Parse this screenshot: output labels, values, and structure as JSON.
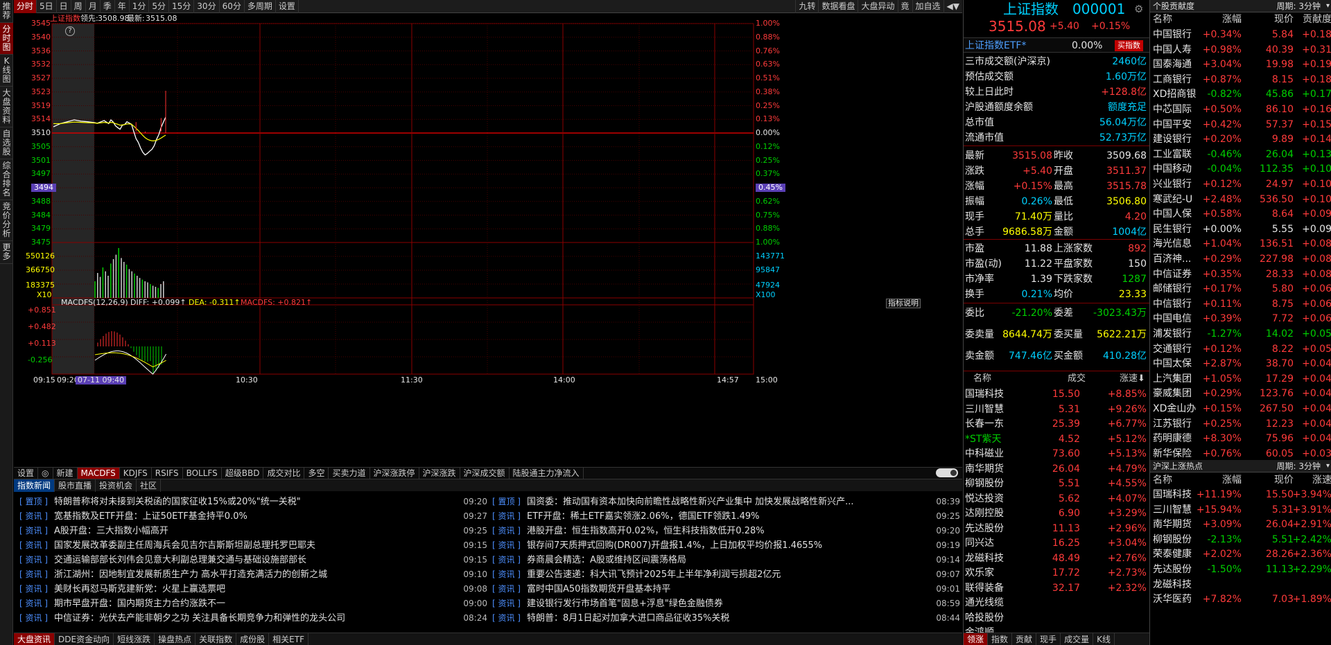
{
  "sidebar": [
    "推荐",
    "分时图",
    "K线图",
    "大盘资料",
    "自选股",
    "综合排名",
    "竞价分析",
    "更多"
  ],
  "toolbar": {
    "left": [
      "分时",
      "5日",
      "日",
      "周",
      "月",
      "季",
      "年",
      "1分",
      "5分",
      "15分",
      "30分",
      "60分",
      "多周期",
      "设置"
    ],
    "right": [
      "九转",
      "数据看盘",
      "大盘异动",
      "竟",
      "加自选",
      "◀▼"
    ]
  },
  "chart": {
    "title": "上证指数",
    "lead_label": "领先:",
    "lead_value": "3508.98",
    "latest_label": "最新:",
    "latest_value": "3515.08",
    "price_levels": [
      "3545",
      "3540",
      "3536",
      "3532",
      "3527",
      "3523",
      "3519",
      "3514",
      "3510",
      "3505",
      "3501",
      "3497",
      "3494",
      "3488",
      "3484",
      "3479",
      "3475"
    ],
    "pct_levels": [
      "1.00%",
      "0.88%",
      "0.76%",
      "0.63%",
      "0.51%",
      "0.38%",
      "0.25%",
      "0.13%",
      "0.00%",
      "0.12%",
      "0.25%",
      "0.37%",
      "0.45%",
      "0.62%",
      "0.75%",
      "0.88%",
      "1.00%"
    ],
    "vol_left": [
      "550126",
      "366750",
      "183375",
      "X10"
    ],
    "vol_right": [
      "143771",
      "95847",
      "47924",
      "X100"
    ],
    "macd_levels": [
      "+0.851",
      "+0.482",
      "+0.113",
      "-0.256"
    ],
    "macd_label": "MACDFS(12,26,9)",
    "macd_diff": "DIFF: +0.099↑",
    "macd_dea": "DEA: -0.311↑",
    "macd_macdfs": "MACDFS: +0.821↑",
    "indicator_button": "指标说明",
    "time_labels": [
      "09:15",
      "09:20",
      "10:30",
      "11:30",
      "14:00",
      "14:57",
      "15:00"
    ],
    "cursor_time": "07-11 09:40",
    "help": "?"
  },
  "index_tabs": [
    "设置",
    "◎",
    "新建",
    "MACDFS",
    "KDJFS",
    "RSIFS",
    "BOLLFS",
    "超级BBD",
    "成交对比",
    "多空",
    "买卖力道",
    "沪深涨跌停",
    "沪深涨跌",
    "沪深成交额",
    "陆股通主力净流入"
  ],
  "news_tabs": [
    "指数新闻",
    "股市直播",
    "投资机会",
    "社区"
  ],
  "news_left": [
    {
      "tag": "[ 置顶 ]",
      "title": "特朗普称将对未接到关税函的国家征收15%或20%\"统一关税\"",
      "time": "09:20"
    },
    {
      "tag": "[ 资讯 ]",
      "title": "宽基指数及ETF开盘：上证50ETF基金持平0.0%",
      "time": "09:27"
    },
    {
      "tag": "[ 资讯 ]",
      "title": "A股开盘：三大指数小幅高开",
      "time": "09:25"
    },
    {
      "tag": "[ 资讯 ]",
      "title": "国家发展改革委副主任周海兵会见吉尔吉斯斯坦副总理托罗巴耶夫",
      "time": "09:15"
    },
    {
      "tag": "[ 资讯 ]",
      "title": "交通运输部部长刘伟会见意大利副总理兼交通与基础设施部部长",
      "time": "09:15"
    },
    {
      "tag": "[ 资讯 ]",
      "title": "浙江湖州：因地制宜发展新质生产力 高水平打造充满活力的创新之城",
      "time": "09:10"
    },
    {
      "tag": "[ 资讯 ]",
      "title": "美财长再怼马斯克建新党：火星上赢选票吧",
      "time": "09:08"
    },
    {
      "tag": "[ 资讯 ]",
      "title": "期市早盘开盘：国内期货主力合约涨跌不一",
      "time": "09:00"
    },
    {
      "tag": "[ 资讯 ]",
      "title": "中信证券：光伏去产能非朝夕之功 关注具备长期竞争力和弹性的龙头公司",
      "time": "08:24"
    }
  ],
  "news_right": [
    {
      "tag": "[ 置顶 ]",
      "title": "国资委：推动国有资本加快向前瞻性战略性新兴产业集中 加快发展战略性新兴产...",
      "time": "08:39"
    },
    {
      "tag": "[ 资讯 ]",
      "title": "ETF开盘：稀土ETF嘉实领涨2.06%，德国ETF领跌1.49%",
      "time": "09:25"
    },
    {
      "tag": "[ 资讯 ]",
      "title": "港股开盘：恒生指数高开0.02%，恒生科技指数低开0.28%",
      "time": "09:20"
    },
    {
      "tag": "[ 资讯 ]",
      "title": "银存间7天质押式回购(DR007)开盘报1.4%，上日加权平均价报1.4655%",
      "time": "09:19"
    },
    {
      "tag": "[ 资讯 ]",
      "title": "券商晨会精选：A股或维持区间震荡格局",
      "time": "09:14"
    },
    {
      "tag": "[ 资讯 ]",
      "title": "重要公告速递：科大讯飞预计2025年上半年净利润亏损超2亿元",
      "time": "09:07"
    },
    {
      "tag": "[ 资讯 ]",
      "title": "富时中国A50指数期货开盘基本持平",
      "time": "09:01"
    },
    {
      "tag": "[ 资讯 ]",
      "title": "建设银行发行市场首笔\"固息+浮息\"绿色金融债券",
      "time": "08:59"
    },
    {
      "tag": "[ 资讯 ]",
      "title": "特朗普：8月1日起对加拿大进口商品征收35%关税",
      "time": "08:44"
    }
  ],
  "bottom_tabs": [
    "大盘资讯",
    "DDE资金动向",
    "短线涨跌",
    "操盘热点",
    "关联指数",
    "成份股",
    "相关ETF"
  ],
  "info": {
    "name": "上证指数",
    "code": "000001",
    "price": "3515.08",
    "change": "+5.40",
    "pct": "+0.15%",
    "etf_name": "上证指数ETF*",
    "etf_pct": "0.00%",
    "etf_btn": "买指数",
    "rows1": [
      {
        "label": "三市成交额(沪深京)",
        "value": "2460亿",
        "cls": "cyan"
      },
      {
        "label": "预估成交额",
        "value": "1.60万亿",
        "cls": "cyan"
      },
      {
        "label": "较上日此时",
        "value": "+128.8亿",
        "cls": "red"
      },
      {
        "label": "沪股通额度余额",
        "value": "额度充足",
        "cls": "cyan"
      },
      {
        "label": "总市值",
        "value": "56.04万亿",
        "cls": "cyan"
      },
      {
        "label": "流通市值",
        "value": "52.73万亿",
        "cls": "cyan"
      }
    ],
    "quote": [
      {
        "l1": "最新",
        "v1": "3515.08",
        "c1": "red",
        "l2": "昨收",
        "v2": "3509.68",
        "c2": "white"
      },
      {
        "l1": "涨跌",
        "v1": "+5.40",
        "c1": "red",
        "l2": "开盘",
        "v2": "3511.37",
        "c2": "red"
      },
      {
        "l1": "涨幅",
        "v1": "+0.15%",
        "c1": "red",
        "l2": "最高",
        "v2": "3515.78",
        "c2": "red"
      },
      {
        "l1": "振幅",
        "v1": "0.26%",
        "c1": "cyan",
        "l2": "最低",
        "v2": "3506.80",
        "c2": "yellow"
      },
      {
        "l1": "现手",
        "v1": "71.40万",
        "c1": "yellow",
        "l2": "量比",
        "v2": "4.20",
        "c2": "red"
      },
      {
        "l1": "总手",
        "v1": "9686.58万",
        "c1": "yellow",
        "l2": "金额",
        "v2": "1004亿",
        "c2": "cyan"
      }
    ],
    "stats": [
      {
        "l1": "市盈",
        "v1": "11.88",
        "c1": "white",
        "l2": "上涨家数",
        "v2": "892",
        "c2": "red"
      },
      {
        "l1": "市盈(动)",
        "v1": "11.22",
        "c1": "white",
        "l2": "平盘家数",
        "v2": "150",
        "c2": "white"
      },
      {
        "l1": "市净率",
        "v1": "1.39",
        "c1": "white",
        "l2": "下跌家数",
        "v2": "1287",
        "c2": "green"
      },
      {
        "l1": "换手",
        "v1": "0.21%",
        "c1": "cyan",
        "l2": "均价",
        "v2": "23.33",
        "c2": "yellow"
      }
    ],
    "bid": [
      {
        "l1": "委比",
        "v1": "-21.20%",
        "c1": "green",
        "l2": "委差",
        "v2": "-3023.43万",
        "c2": "green"
      },
      {
        "l1": "委卖量",
        "v1": "8644.74万",
        "c1": "yellow",
        "l2": "委买量",
        "v2": "5622.21万",
        "c2": "yellow"
      },
      {
        "l1": "卖金额",
        "v1": "747.46亿",
        "c1": "cyan",
        "l2": "买金额",
        "v2": "410.28亿",
        "c2": "cyan"
      }
    ],
    "list_header": {
      "name": "名称",
      "price": "成交",
      "pct": "涨速⬇"
    },
    "list": [
      {
        "name": "国瑞科技",
        "price": "15.50",
        "pct": "+8.85%",
        "c": "red",
        "nc": "white"
      },
      {
        "name": "三川智慧",
        "price": "5.31",
        "pct": "+9.26%",
        "c": "red",
        "nc": "white"
      },
      {
        "name": "长春一东",
        "price": "25.39",
        "pct": "+6.77%",
        "c": "red",
        "nc": "white"
      },
      {
        "name": "*ST紫天",
        "price": "4.52",
        "pct": "+5.12%",
        "c": "red",
        "nc": "green"
      },
      {
        "name": "中科磁业",
        "price": "73.60",
        "pct": "+5.13%",
        "c": "red",
        "nc": "white"
      },
      {
        "name": "南华期货",
        "price": "26.04",
        "pct": "+4.79%",
        "c": "red",
        "nc": "white"
      },
      {
        "name": "柳钢股份",
        "price": "5.51",
        "pct": "+4.55%",
        "c": "red",
        "nc": "white"
      },
      {
        "name": "悦达投资",
        "price": "5.62",
        "pct": "+4.07%",
        "c": "red",
        "nc": "white"
      },
      {
        "name": "达刚控股",
        "price": "6.90",
        "pct": "+3.29%",
        "c": "red",
        "nc": "white"
      },
      {
        "name": "先达股份",
        "price": "11.13",
        "pct": "+2.96%",
        "c": "red",
        "nc": "white"
      },
      {
        "name": "同兴达",
        "price": "16.25",
        "pct": "+3.04%",
        "c": "red",
        "nc": "white"
      },
      {
        "name": "龙磁科技",
        "price": "48.49",
        "pct": "+2.76%",
        "c": "red",
        "nc": "white"
      },
      {
        "name": "欢乐家",
        "price": "17.72",
        "pct": "+2.73%",
        "c": "red",
        "nc": "white"
      },
      {
        "name": "联得装备",
        "price": "32.17",
        "pct": "+2.32%",
        "c": "red",
        "nc": "white"
      },
      {
        "name": "通光线缆",
        "price": "",
        "pct": "",
        "c": "red",
        "nc": "white"
      },
      {
        "name": "哈投股份",
        "price": "",
        "pct": "",
        "c": "red",
        "nc": "white"
      },
      {
        "name": "金鸿顺",
        "price": "",
        "pct": "",
        "c": "red",
        "nc": "white"
      }
    ],
    "tabs": [
      "领涨",
      "指数",
      "贡献",
      "现手",
      "成交量",
      "K线"
    ]
  },
  "contrib": {
    "header": "个股贡献度",
    "period": "周期: 3分钟",
    "cols": {
      "name": "名称",
      "pct": "涨幅",
      "price": "现价",
      "con": "贡献度"
    },
    "rows": [
      {
        "name": "中国银行",
        "pct": "+0.34%",
        "price": "5.84",
        "con": "+0.18",
        "c": "red"
      },
      {
        "name": "中国人寿",
        "pct": "+0.98%",
        "price": "40.39",
        "con": "+0.31",
        "c": "red"
      },
      {
        "name": "国泰海通",
        "pct": "+3.04%",
        "price": "19.98",
        "con": "+0.19",
        "c": "red"
      },
      {
        "name": "工商银行",
        "pct": "+0.87%",
        "price": "8.15",
        "con": "+0.18",
        "c": "red"
      },
      {
        "name": "XD招商银",
        "pct": "-0.82%",
        "price": "45.86",
        "con": "+0.17",
        "c": "green"
      },
      {
        "name": "中芯国际",
        "pct": "+0.50%",
        "price": "86.10",
        "con": "+0.16",
        "c": "red"
      },
      {
        "name": "中国平安",
        "pct": "+0.42%",
        "price": "57.37",
        "con": "+0.15",
        "c": "red"
      },
      {
        "name": "建设银行",
        "pct": "+0.20%",
        "price": "9.89",
        "con": "+0.14",
        "c": "red"
      },
      {
        "name": "工业富联",
        "pct": "-0.46%",
        "price": "26.04",
        "con": "+0.13",
        "c": "green"
      },
      {
        "name": "中国移动",
        "pct": "-0.04%",
        "price": "112.35",
        "con": "+0.10",
        "c": "green"
      },
      {
        "name": "兴业银行",
        "pct": "+0.12%",
        "price": "24.97",
        "con": "+0.10",
        "c": "red"
      },
      {
        "name": "寒武纪-U",
        "pct": "+2.48%",
        "price": "536.50",
        "con": "+0.10",
        "c": "red"
      },
      {
        "name": "中国人保",
        "pct": "+0.58%",
        "price": "8.64",
        "con": "+0.09",
        "c": "red"
      },
      {
        "name": "民生银行",
        "pct": "+0.00%",
        "price": "5.55",
        "con": "+0.09",
        "c": "white"
      },
      {
        "name": "海光信息",
        "pct": "+1.04%",
        "price": "136.51",
        "con": "+0.08",
        "c": "red"
      },
      {
        "name": "百济神...",
        "pct": "+0.29%",
        "price": "227.98",
        "con": "+0.08",
        "c": "red"
      },
      {
        "name": "中信证券",
        "pct": "+0.35%",
        "price": "28.33",
        "con": "+0.08",
        "c": "red",
        "nc": "green"
      },
      {
        "name": "邮储银行",
        "pct": "+0.17%",
        "price": "5.80",
        "con": "+0.06",
        "c": "red"
      },
      {
        "name": "中信银行",
        "pct": "+0.11%",
        "price": "8.75",
        "con": "+0.06",
        "c": "red"
      },
      {
        "name": "中国电信",
        "pct": "+0.39%",
        "price": "7.72",
        "con": "+0.06",
        "c": "red"
      },
      {
        "name": "浦发银行",
        "pct": "-1.27%",
        "price": "14.02",
        "con": "+0.05",
        "c": "green"
      },
      {
        "name": "交通银行",
        "pct": "+0.12%",
        "price": "8.22",
        "con": "+0.05",
        "c": "red"
      },
      {
        "name": "中国太保",
        "pct": "+2.87%",
        "price": "38.70",
        "con": "+0.04",
        "c": "red"
      },
      {
        "name": "上汽集团",
        "pct": "+1.05%",
        "price": "17.29",
        "con": "+0.04",
        "c": "red"
      },
      {
        "name": "豪威集团",
        "pct": "+0.29%",
        "price": "123.76",
        "con": "+0.04",
        "c": "red"
      },
      {
        "name": "XD金山办",
        "pct": "+0.15%",
        "price": "267.50",
        "con": "+0.04",
        "c": "red"
      },
      {
        "name": "江苏银行",
        "pct": "+0.25%",
        "price": "12.23",
        "con": "+0.04",
        "c": "red"
      },
      {
        "name": "药明康德",
        "pct": "+8.30%",
        "price": "75.96",
        "con": "+0.04",
        "c": "red"
      },
      {
        "name": "新华保险",
        "pct": "+0.76%",
        "price": "60.05",
        "con": "+0.03",
        "c": "red"
      }
    ],
    "hot_header": "沪深上涨热点",
    "hot_period": "周期: 3分钟",
    "hot_cols": {
      "name": "名称",
      "pct": "涨幅",
      "price": "现价",
      "speed": "涨速"
    },
    "hot_rows": [
      {
        "name": "国瑞科技",
        "pct": "+11.19%",
        "price": "15.50",
        "con": "+3.94%",
        "c": "red"
      },
      {
        "name": "三川智慧",
        "pct": "+15.94%",
        "price": "5.31",
        "con": "+3.91%",
        "c": "red"
      },
      {
        "name": "南华期货",
        "pct": "+3.09%",
        "price": "26.04",
        "con": "+2.91%",
        "c": "red"
      },
      {
        "name": "柳钢股份",
        "pct": "-2.13%",
        "price": "5.51",
        "con": "+2.42%",
        "c": "green"
      },
      {
        "name": "荣泰健康",
        "pct": "+2.02%",
        "price": "28.26",
        "con": "+2.36%",
        "c": "red"
      },
      {
        "name": "先达股份",
        "pct": "-1.50%",
        "price": "11.13",
        "con": "+2.29%",
        "c": "green"
      },
      {
        "name": "龙磁科技",
        "pct": "",
        "price": "",
        "con": "",
        "c": "red"
      },
      {
        "name": "沃华医药",
        "pct": "+7.82%",
        "price": "7.03",
        "con": "+1.89%",
        "c": "red"
      }
    ]
  }
}
